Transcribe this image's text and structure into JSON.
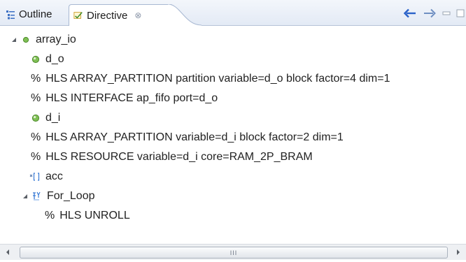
{
  "tabs": [
    {
      "label": "Outline",
      "icon": "outline-icon"
    },
    {
      "label": "Directive",
      "icon": "directive-icon",
      "close": "⊗"
    }
  ],
  "toolbar": {
    "back_icon": "arrow-left-icon",
    "forward_icon": "arrow-right-icon",
    "minimize_icon": "minimize-icon",
    "maximize_icon": "maximize-icon"
  },
  "tree": {
    "root": {
      "label": "array_io",
      "icon": "function-icon"
    },
    "items": [
      {
        "label": "d_o",
        "icon": "port-icon"
      },
      {
        "label": "HLS ARRAY_PARTITION partition variable=d_o block factor=4 dim=1",
        "prefix": "%"
      },
      {
        "label": "HLS INTERFACE ap_fifo port=d_o",
        "prefix": "%"
      },
      {
        "label": "d_i",
        "icon": "port-icon"
      },
      {
        "label": "HLS ARRAY_PARTITION variable=d_i block factor=2 dim=1",
        "prefix": "%"
      },
      {
        "label": "HLS RESOURCE variable=d_i core=RAM_2P_BRAM",
        "prefix": "%"
      },
      {
        "label": "acc",
        "icon": "array-variable-icon"
      },
      {
        "label": "For_Loop",
        "icon": "loop-icon"
      },
      {
        "label": "HLS UNROLL",
        "prefix": "%"
      }
    ]
  },
  "scrollbar": {
    "grip": "III"
  },
  "colors": {
    "arrow_blue": "#2a62c9",
    "port_green": "#5fa63b",
    "loop_blue": "#3a7bd5"
  }
}
